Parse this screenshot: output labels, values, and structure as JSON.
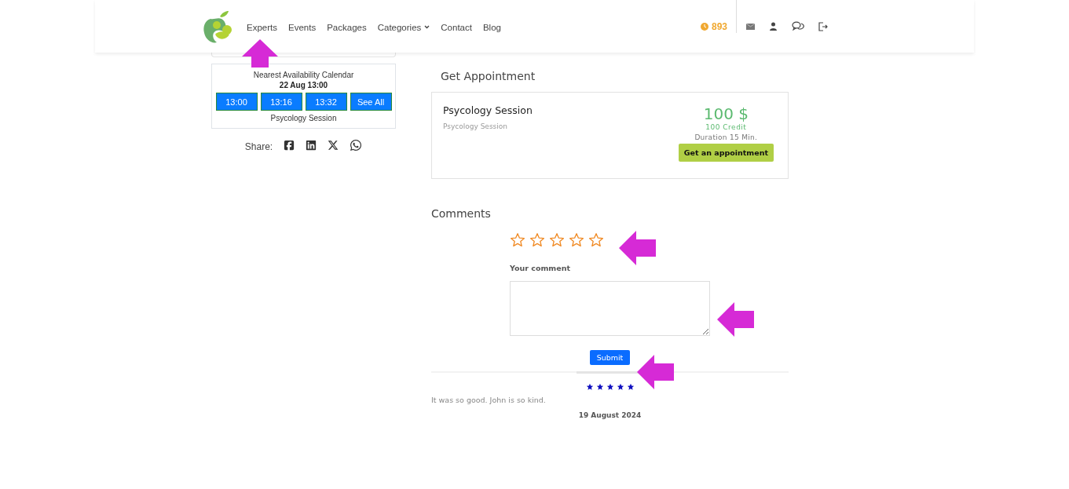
{
  "nav": {
    "items": [
      {
        "label": "Experts",
        "has_caret": false
      },
      {
        "label": "Events",
        "has_caret": false
      },
      {
        "label": "Packages",
        "has_caret": false
      },
      {
        "label": "Categories",
        "has_caret": true
      },
      {
        "label": "Contact",
        "has_caret": false
      },
      {
        "label": "Blog",
        "has_caret": false
      }
    ],
    "credits": "893"
  },
  "availability": {
    "title": "Nearest Availability Calendar",
    "date": "22 Aug 13:00",
    "slots": [
      "13:00",
      "13:16",
      "13:32",
      "See All"
    ],
    "session": "Psycology Session"
  },
  "share": {
    "label": "Share:"
  },
  "appointment": {
    "heading": "Get Appointment",
    "title": "Psycology Session",
    "subtitle": "Psycology Session",
    "price": "100 $",
    "credit": "100 Credit",
    "duration": "Duration 15 Min.",
    "button": "Get an appointment"
  },
  "comments": {
    "heading": "Comments",
    "rating": {
      "stars": 0
    },
    "label": "Your comment",
    "submit": "Submit",
    "reviews": [
      {
        "stars": 5,
        "text": "It was so good. John is so kind.",
        "date": "19 August 2024"
      }
    ]
  }
}
